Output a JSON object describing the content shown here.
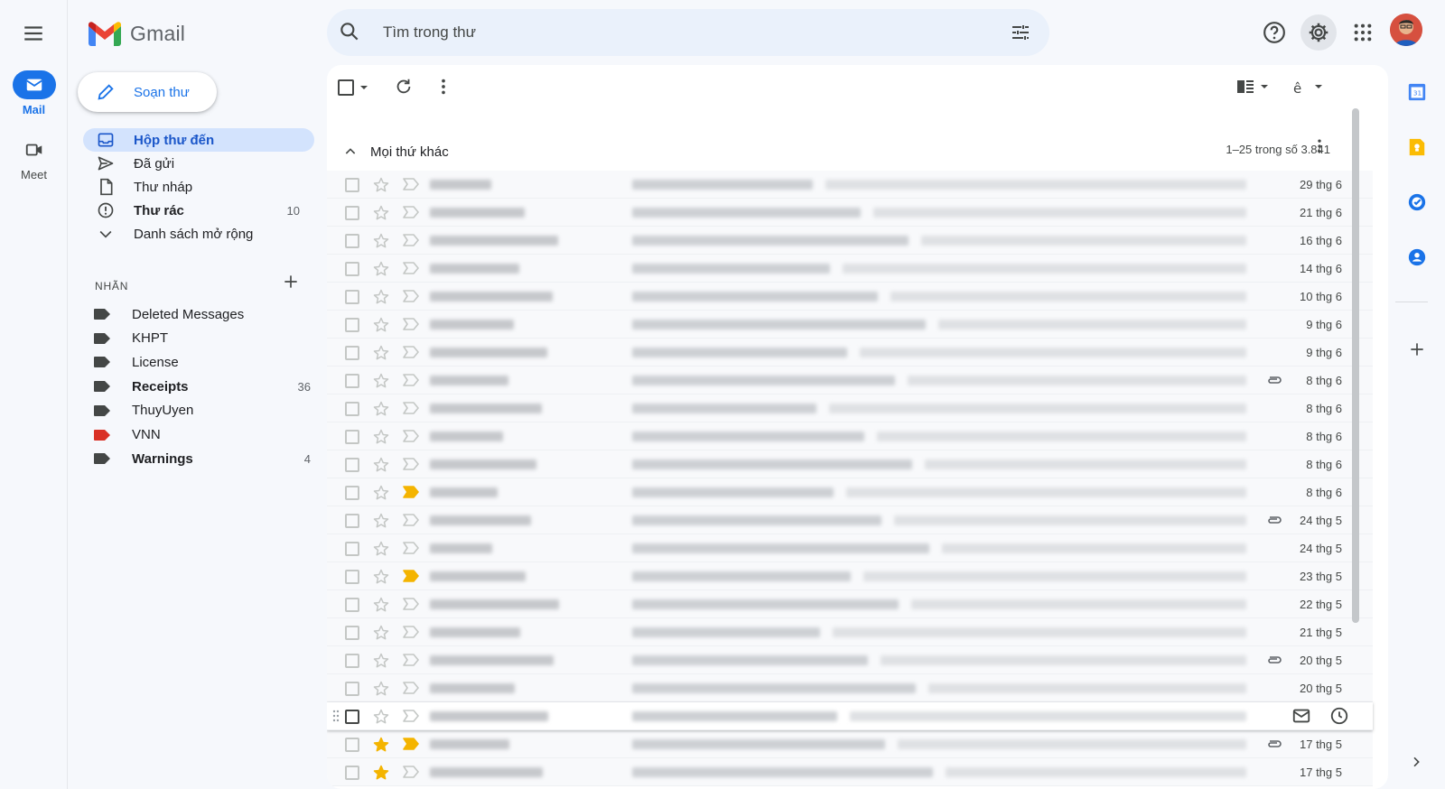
{
  "app": {
    "name": "Gmail"
  },
  "rail": {
    "mail_label": "Mail",
    "meet_label": "Meet"
  },
  "search": {
    "placeholder": "Tìm trong thư"
  },
  "compose": {
    "label": "Soạn thư"
  },
  "nav": [
    {
      "label": "Hộp thư đến",
      "count": "",
      "icon": "inbox-icon",
      "active": true
    },
    {
      "label": "Đã gửi",
      "count": "",
      "icon": "send-icon"
    },
    {
      "label": "Thư nháp",
      "count": "",
      "icon": "draft-icon"
    },
    {
      "label": "Thư rác",
      "count": "10",
      "icon": "spam-icon",
      "bold": true
    },
    {
      "label": "Danh sách mở rộng",
      "count": "",
      "icon": "chevron-down-icon"
    }
  ],
  "labels": {
    "heading": "NHÃN",
    "items": [
      {
        "label": "Deleted Messages",
        "count": "",
        "color": "#444746"
      },
      {
        "label": "KHPT",
        "count": "",
        "color": "#444746"
      },
      {
        "label": "License",
        "count": "",
        "color": "#444746"
      },
      {
        "label": "Receipts",
        "count": "36",
        "color": "#444746",
        "bold": true
      },
      {
        "label": "ThuyUyen",
        "count": "",
        "color": "#444746"
      },
      {
        "label": "VNN",
        "count": "",
        "color": "#d93025"
      },
      {
        "label": "Warnings",
        "count": "4",
        "color": "#444746",
        "bold": true
      }
    ]
  },
  "section": {
    "title": "Mọi thứ khác",
    "page_info": "1–25 trong số 3.841"
  },
  "emails": [
    {
      "date": "29 thg 6",
      "important": false,
      "starred": false,
      "attachment": false
    },
    {
      "date": "21 thg 6",
      "important": false,
      "starred": false,
      "attachment": false
    },
    {
      "date": "16 thg 6",
      "important": false,
      "starred": false,
      "attachment": false
    },
    {
      "date": "14 thg 6",
      "important": false,
      "starred": false,
      "attachment": false
    },
    {
      "date": "10 thg 6",
      "important": false,
      "starred": false,
      "attachment": false
    },
    {
      "date": "9 thg 6",
      "important": false,
      "starred": false,
      "attachment": false
    },
    {
      "date": "9 thg 6",
      "important": false,
      "starred": false,
      "attachment": false
    },
    {
      "date": "8 thg 6",
      "important": false,
      "starred": false,
      "attachment": true
    },
    {
      "date": "8 thg 6",
      "important": false,
      "starred": false,
      "attachment": false
    },
    {
      "date": "8 thg 6",
      "important": false,
      "starred": false,
      "attachment": false
    },
    {
      "date": "8 thg 6",
      "important": false,
      "starred": false,
      "attachment": false
    },
    {
      "date": "8 thg 6",
      "important": true,
      "starred": false,
      "attachment": false
    },
    {
      "date": "24 thg 5",
      "important": false,
      "starred": false,
      "attachment": true
    },
    {
      "date": "24 thg 5",
      "important": false,
      "starred": false,
      "attachment": false
    },
    {
      "date": "23 thg 5",
      "important": true,
      "starred": false,
      "attachment": false
    },
    {
      "date": "22 thg 5",
      "important": false,
      "starred": false,
      "attachment": false
    },
    {
      "date": "21 thg 5",
      "important": false,
      "starred": false,
      "attachment": false
    },
    {
      "date": "20 thg 5",
      "important": false,
      "starred": false,
      "attachment": true
    },
    {
      "date": "20 thg 5",
      "important": false,
      "starred": false,
      "attachment": false
    },
    {
      "date": "",
      "important": false,
      "starred": false,
      "attachment": false,
      "hovered": true
    },
    {
      "date": "17 thg 5",
      "important": true,
      "starred": true,
      "attachment": true
    },
    {
      "date": "17 thg 5",
      "important": false,
      "starred": true,
      "attachment": false
    }
  ],
  "colors": {
    "accent": "#1a73e8",
    "active_bg": "#d3e3fd",
    "important": "#f4b400",
    "star": "#f4b400"
  }
}
